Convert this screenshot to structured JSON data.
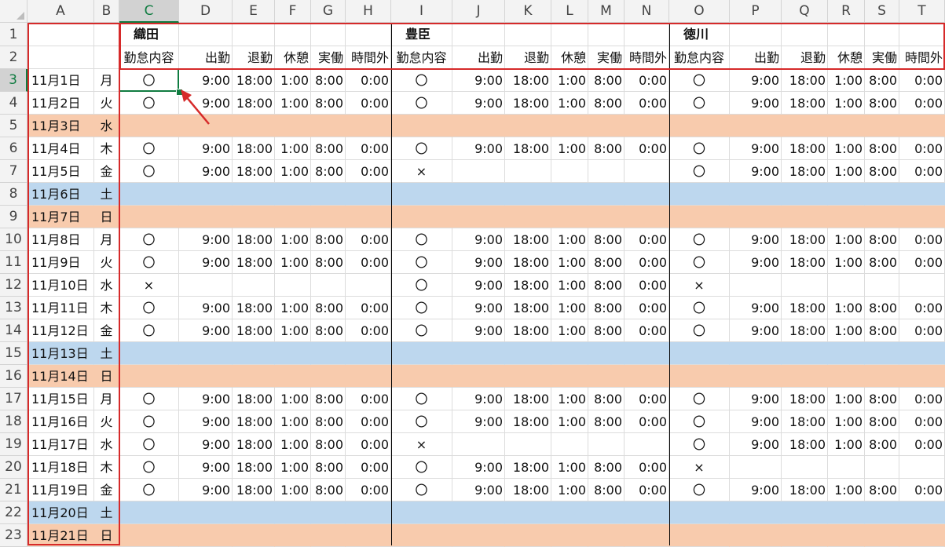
{
  "columns": [
    "A",
    "B",
    "C",
    "D",
    "E",
    "F",
    "G",
    "H",
    "I",
    "J",
    "K",
    "L",
    "M",
    "N",
    "O",
    "P",
    "Q",
    "R",
    "S",
    "T"
  ],
  "selected_cell": {
    "col": "C",
    "row": "3"
  },
  "people": [
    "織田",
    "豊臣",
    "徳川"
  ],
  "subheaders": [
    "勤怠内容",
    "出勤",
    "退勤",
    "休憩",
    "実働",
    "時間外"
  ],
  "rows": [
    {
      "n": "1"
    },
    {
      "n": "2"
    },
    {
      "n": "3",
      "date": "11月1日",
      "dow": "月",
      "type": "work",
      "p": [
        "w",
        "w",
        "w"
      ]
    },
    {
      "n": "4",
      "date": "11月2日",
      "dow": "火",
      "type": "work",
      "p": [
        "w",
        "w",
        "w"
      ]
    },
    {
      "n": "5",
      "date": "11月3日",
      "dow": "水",
      "type": "holiday"
    },
    {
      "n": "6",
      "date": "11月4日",
      "dow": "木",
      "type": "work",
      "p": [
        "w",
        "w",
        "w"
      ]
    },
    {
      "n": "7",
      "date": "11月5日",
      "dow": "金",
      "type": "work",
      "p": [
        "w",
        "x",
        "w"
      ]
    },
    {
      "n": "8",
      "date": "11月6日",
      "dow": "土",
      "type": "sat"
    },
    {
      "n": "9",
      "date": "11月7日",
      "dow": "日",
      "type": "holiday"
    },
    {
      "n": "10",
      "date": "11月8日",
      "dow": "月",
      "type": "work",
      "p": [
        "w",
        "w",
        "w"
      ]
    },
    {
      "n": "11",
      "date": "11月9日",
      "dow": "火",
      "type": "work",
      "p": [
        "w",
        "w",
        "w"
      ]
    },
    {
      "n": "12",
      "date": "11月10日",
      "dow": "水",
      "type": "work",
      "p": [
        "x",
        "w",
        "x"
      ]
    },
    {
      "n": "13",
      "date": "11月11日",
      "dow": "木",
      "type": "work",
      "p": [
        "w",
        "w",
        "w"
      ]
    },
    {
      "n": "14",
      "date": "11月12日",
      "dow": "金",
      "type": "work",
      "p": [
        "w",
        "w",
        "w"
      ]
    },
    {
      "n": "15",
      "date": "11月13日",
      "dow": "土",
      "type": "sat"
    },
    {
      "n": "16",
      "date": "11月14日",
      "dow": "日",
      "type": "holiday"
    },
    {
      "n": "17",
      "date": "11月15日",
      "dow": "月",
      "type": "work",
      "p": [
        "w",
        "w",
        "w"
      ]
    },
    {
      "n": "18",
      "date": "11月16日",
      "dow": "火",
      "type": "work",
      "p": [
        "w",
        "w",
        "w"
      ]
    },
    {
      "n": "19",
      "date": "11月17日",
      "dow": "水",
      "type": "work",
      "p": [
        "w",
        "x",
        "w"
      ]
    },
    {
      "n": "20",
      "date": "11月18日",
      "dow": "木",
      "type": "work",
      "p": [
        "w",
        "w",
        "x"
      ]
    },
    {
      "n": "21",
      "date": "11月19日",
      "dow": "金",
      "type": "work",
      "p": [
        "w",
        "w",
        "w"
      ]
    },
    {
      "n": "22",
      "date": "11月20日",
      "dow": "土",
      "type": "sat"
    },
    {
      "n": "23",
      "date": "11月21日",
      "dow": "日",
      "type": "holiday"
    }
  ],
  "work_values": {
    "mark": "〇",
    "start": "9:00",
    "end": "18:00",
    "break": "1:00",
    "actual": "8:00",
    "overtime": "0:00"
  },
  "absent_mark": "×",
  "colors": {
    "holiday": "#f8cbad",
    "sat": "#bdd7ee",
    "selection": "#107c41",
    "annotation": "#d62a2a"
  }
}
